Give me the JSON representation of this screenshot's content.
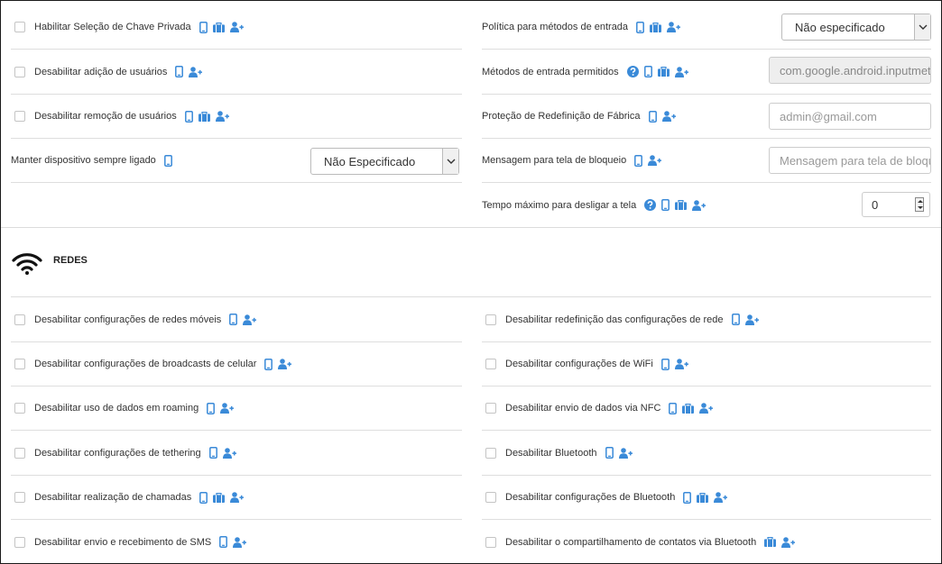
{
  "colors": {
    "icon_blue": "#3a8ad8",
    "border": "#dedede"
  },
  "top_left": [
    {
      "label": "Habilitar Seleção de Chave Privada",
      "checkbox": true,
      "icons": [
        "phone-icon",
        "briefcase-icon",
        "add-user-icon"
      ]
    },
    {
      "label": "Desabilitar adição de usuários",
      "checkbox": true,
      "icons": [
        "phone-icon",
        "add-user-icon"
      ]
    },
    {
      "label": "Desabilitar remoção de usuários",
      "checkbox": true,
      "icons": [
        "phone-icon",
        "briefcase-icon",
        "add-user-icon"
      ]
    },
    {
      "label": "Manter dispositivo sempre ligado",
      "checkbox": false,
      "icons": [
        "phone-icon"
      ],
      "select_value": "Não Especificado"
    }
  ],
  "top_right": [
    {
      "label": "Política para métodos de entrada",
      "icons": [
        "phone-icon",
        "briefcase-icon",
        "add-user-icon"
      ],
      "select_value": "Não especificado"
    },
    {
      "label": "Métodos de entrada permitidos",
      "help": true,
      "icons": [
        "phone-icon",
        "briefcase-icon",
        "add-user-icon"
      ],
      "input_value": "com.google.android.inputmet"
    },
    {
      "label": "Proteção de Redefinição de Fábrica",
      "icons": [
        "phone-icon",
        "add-user-icon"
      ],
      "input_placeholder": "admin@gmail.com"
    },
    {
      "label": "Mensagem para tela de bloqueio",
      "icons": [
        "phone-icon",
        "add-user-icon"
      ],
      "input_placeholder": "Mensagem para tela de bloqu"
    },
    {
      "label": "Tempo máximo para desligar a tela",
      "help": true,
      "icons": [
        "phone-icon",
        "briefcase-icon",
        "add-user-icon"
      ],
      "number_value": "0"
    }
  ],
  "section": {
    "title": "REDES",
    "icon": "wifi-icon"
  },
  "net_left": [
    {
      "label": "Desabilitar configurações de redes móveis",
      "icons": [
        "phone-icon",
        "add-user-icon"
      ]
    },
    {
      "label": "Desabilitar configurações de broadcasts de celular",
      "icons": [
        "phone-icon",
        "add-user-icon"
      ]
    },
    {
      "label": "Desabilitar uso de dados em roaming",
      "icons": [
        "phone-icon",
        "add-user-icon"
      ]
    },
    {
      "label": "Desabilitar configurações de tethering",
      "icons": [
        "phone-icon",
        "add-user-icon"
      ]
    },
    {
      "label": "Desabilitar realização de chamadas",
      "icons": [
        "phone-icon",
        "briefcase-icon",
        "add-user-icon"
      ]
    },
    {
      "label": "Desabilitar envio e recebimento de SMS",
      "icons": [
        "phone-icon",
        "add-user-icon"
      ]
    }
  ],
  "net_right": [
    {
      "label": "Desabilitar redefinição das configurações de rede",
      "icons": [
        "phone-icon",
        "add-user-icon"
      ]
    },
    {
      "label": "Desabilitar configurações de WiFi",
      "icons": [
        "phone-icon",
        "add-user-icon"
      ]
    },
    {
      "label": "Desabilitar envio de dados via NFC",
      "icons": [
        "phone-icon",
        "briefcase-icon",
        "add-user-icon"
      ]
    },
    {
      "label": "Desabilitar Bluetooth",
      "icons": [
        "phone-icon",
        "add-user-icon"
      ]
    },
    {
      "label": "Desabilitar configurações de Bluetooth",
      "icons": [
        "phone-icon",
        "briefcase-icon",
        "add-user-icon"
      ]
    },
    {
      "label": "Desabilitar o compartilhamento de contatos via Bluetooth",
      "icons": [
        "briefcase-icon",
        "add-user-icon"
      ]
    }
  ]
}
